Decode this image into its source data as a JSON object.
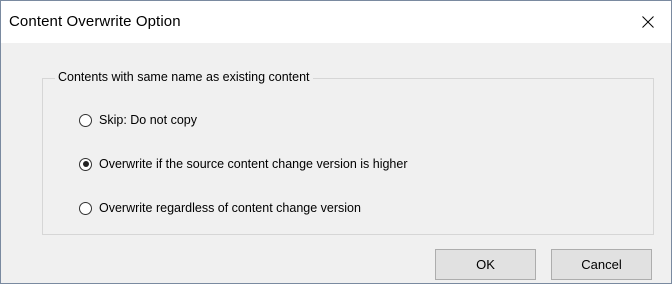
{
  "window": {
    "title": "Content Overwrite Option",
    "close_icon": "close-icon"
  },
  "group": {
    "legend": "Contents with same name as existing content",
    "options": [
      {
        "label": "Skip: Do not copy",
        "selected": false
      },
      {
        "label": "Overwrite if the source content change version is higher",
        "selected": true
      },
      {
        "label": "Overwrite regardless of content change version",
        "selected": false
      }
    ]
  },
  "buttons": {
    "ok_label": "OK",
    "cancel_label": "Cancel"
  },
  "colors": {
    "dialog_background": "#f0f0f0",
    "titlebar_background": "#ffffff",
    "window_border": "#7a8aa0",
    "button_face": "#e1e1e1",
    "button_border": "#adadad"
  }
}
